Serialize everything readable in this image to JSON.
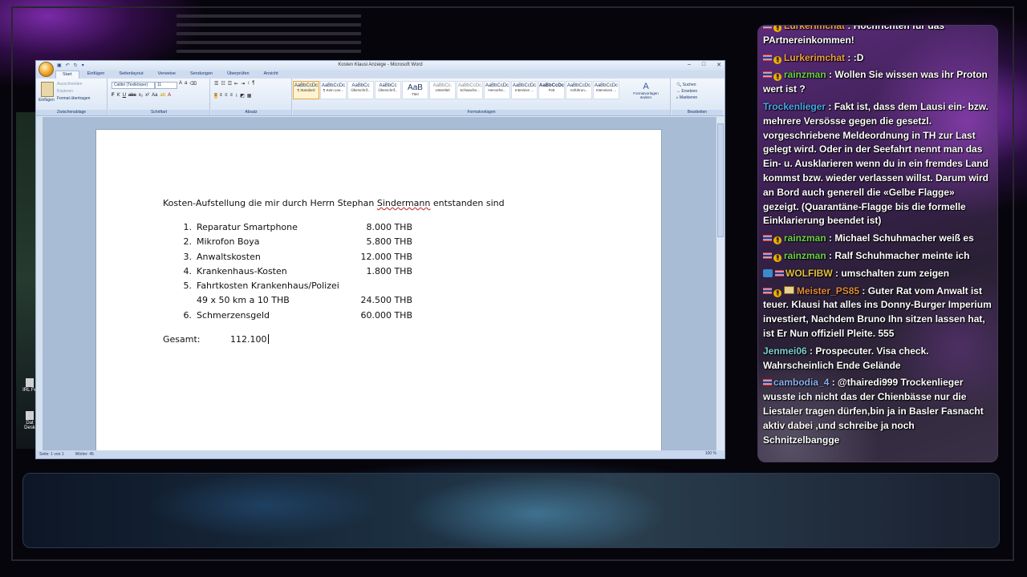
{
  "word": {
    "title": "Kosten Klausi Anzeige - Microsoft Word",
    "tabs": [
      "Start",
      "Einfügen",
      "Seitenlayout",
      "Verweise",
      "Sendungen",
      "Überprüfen",
      "Ansicht"
    ],
    "clipboard": {
      "paste": "Einfügen",
      "cut": "Ausschneiden",
      "copy": "Kopieren",
      "format_painter": "Format übertragen",
      "group": "Zwischenablage"
    },
    "font": {
      "name": "Calibri (Textkörper)",
      "size": "11",
      "group": "Schriftart"
    },
    "paragraph_group": "Absatz",
    "styles": [
      {
        "preview": "AaBbCcDc",
        "name": "¶ Standard",
        "active": true
      },
      {
        "preview": "AaBbCcDc",
        "name": "¶ Kein Lee...",
        "active": false
      },
      {
        "preview": "AaBbCc",
        "name": "Überschrif...",
        "active": false
      },
      {
        "preview": "AaBbCc",
        "name": "Überschrif...",
        "active": false
      },
      {
        "preview": "AaB",
        "name": "Titel",
        "active": false
      },
      {
        "preview": "AaBbCc.",
        "name": "Untertitel",
        "active": false
      },
      {
        "preview": "AaBbCcDc",
        "name": "Schwache...",
        "active": false
      },
      {
        "preview": "AaBbCcDc",
        "name": "Hervorhe...",
        "active": false
      },
      {
        "preview": "AaBbCcDc",
        "name": "Intensive ...",
        "active": false
      },
      {
        "preview": "AaBbCcDc",
        "name": "Fett",
        "active": false
      },
      {
        "preview": "AaBbCcDc",
        "name": "Anführun...",
        "active": false
      },
      {
        "preview": "AaBbCcDc",
        "name": "Intensives ...",
        "active": false
      }
    ],
    "styles_group": "Formatvorlagen",
    "change_styles": "Formatvorlagen ändern",
    "editing": {
      "find": "Suchen",
      "replace": "Ersetzen",
      "select": "Markieren",
      "group": "Bearbeiten"
    },
    "document": {
      "heading_pre": "Kosten-Aufstellung die mir durch Herrn Stephan ",
      "heading_name": "Sindermann",
      "heading_post": " entstanden sind",
      "items": [
        {
          "num": "1.",
          "label": "Reparatur Smartphone",
          "amount": "8.000 THB"
        },
        {
          "num": "2.",
          "label": "Mikrofon Boya",
          "amount": "5.800 THB"
        },
        {
          "num": "3.",
          "label": "Anwaltskosten",
          "amount": "12.000 THB"
        },
        {
          "num": "4.",
          "label": "Krankenhaus-Kosten",
          "amount": "1.800 THB"
        },
        {
          "num": "5.",
          "label": "Fahrtkosten Krankenhaus/Polizei",
          "amount": ""
        },
        {
          "num": "",
          "label": "49 x 50 km a 10 THB",
          "amount": "24.500 THB"
        },
        {
          "num": "6.",
          "label": "Schmerzensgeld",
          "amount": "60.000 THB"
        }
      ],
      "total_label": "Gesamt:",
      "total_value": "112.100"
    },
    "status": {
      "page": "Seite: 1 von 1",
      "words": "Wörter: 45",
      "zoom": "100 %"
    }
  },
  "chat": {
    "messages": [
      {
        "user": "Lurkerimchat",
        "user_color": "#f0a040",
        "badges": [
          "flag",
          "coin"
        ],
        "text": ": Hochrichten für das PArtnereinkommen!"
      },
      {
        "user": "Lurkerimchat",
        "user_color": "#f0a040",
        "badges": [
          "flag",
          "coin"
        ],
        "text": ": :D"
      },
      {
        "user": "rainzman",
        "user_color": "#6cd04a",
        "badges": [
          "flag",
          "coin"
        ],
        "text": ": Wollen Sie wissen was ihr Proton wert ist ?"
      },
      {
        "user": "Trockenlieger",
        "user_color": "#4aa8e8",
        "badges": [],
        "text": ": Fakt ist, dass dem Lausi ein- bzw. mehrere Versösse gegen die gesetzl. vorgeschriebene Meldeordnung in TH zur Last gelegt wird. Oder in der Seefahrt nennt man das Ein- u. Ausklarieren wenn du in ein fremdes Land kommst bzw. wieder verlassen willst. Darum wird an Bord auch generell die «Gelbe Flagge» gezeigt. (Quarantäne-Flagge bis die formelle Einklarierung beendet ist)"
      },
      {
        "user": "rainzman",
        "user_color": "#6cd04a",
        "badges": [
          "flag",
          "coin"
        ],
        "text": ": Michael Schuhmacher weiß es"
      },
      {
        "user": "rainzman",
        "user_color": "#6cd04a",
        "badges": [
          "flag",
          "coin"
        ],
        "text": ": Ralf Schuhmacher meinte ich"
      },
      {
        "user": "WOLFIBW",
        "user_color": "#e0c040",
        "badges": [
          "wolf",
          "flag"
        ],
        "text": ": umschalten zum zeigen"
      },
      {
        "user": "Meister_PS85",
        "user_color": "#e08a3a",
        "badges": [
          "flag",
          "coin",
          "mail"
        ],
        "text": ": Guter Rat vom Anwalt ist teuer. Klausi hat alles ins Donny-Burger Imperium investiert, Nachdem Bruno Ihn sitzen lassen hat, ist Er Nun offiziell Pleite. 555"
      },
      {
        "user": "Jenmei06",
        "user_color": "#7ad0d0",
        "badges": [],
        "text": ": Prospecuter. Visa check. Wahrscheinlich Ende Gelände"
      },
      {
        "user": "cambodia_4",
        "user_color": "#8ab0f0",
        "badges": [
          "flag"
        ],
        "text": ": @thairedi999 Trockenlieger wusste ich nicht das der Chienbässe nur die Liestaler tragen dürfen,bin ja in Basler Fasnacht aktiv dabei ,und schreibe ja noch Schnitzelbangge"
      }
    ]
  },
  "desktop": {
    "icons": [
      {
        "label": "IRL Fe"
      },
      {
        "label": "Dat Desk"
      }
    ]
  }
}
